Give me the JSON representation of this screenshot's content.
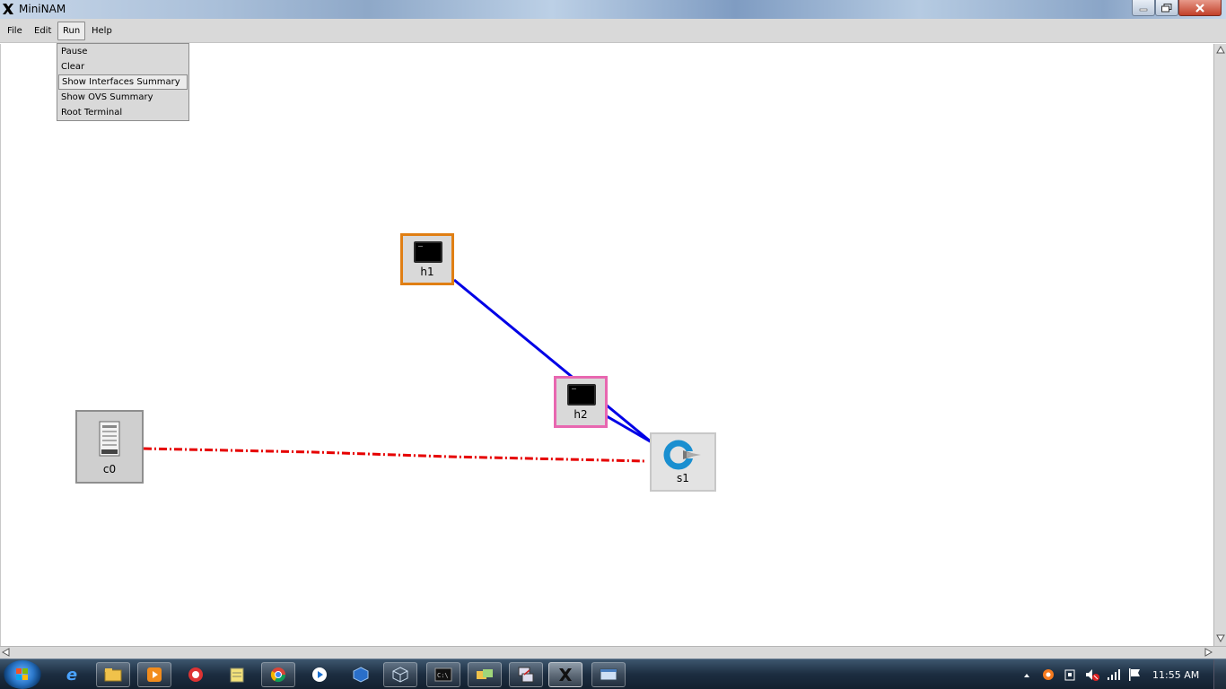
{
  "window": {
    "title": "MiniNAM"
  },
  "menubar": {
    "items": [
      {
        "label": "File"
      },
      {
        "label": "Edit"
      },
      {
        "label": "Run"
      },
      {
        "label": "Help"
      }
    ]
  },
  "run_menu": {
    "items": [
      {
        "label": "Pause"
      },
      {
        "label": "Clear"
      },
      {
        "label": "Show Interfaces Summary",
        "highlighted": true
      },
      {
        "label": "Show OVS Summary"
      },
      {
        "label": "Root Terminal"
      }
    ]
  },
  "topology": {
    "nodes": [
      {
        "id": "h1",
        "label": "h1",
        "kind": "host",
        "border_color": "#e07f14"
      },
      {
        "id": "h2",
        "label": "h2",
        "kind": "host",
        "border_color": "#e867b0"
      },
      {
        "id": "s1",
        "label": "s1",
        "kind": "switch"
      },
      {
        "id": "c0",
        "label": "c0",
        "kind": "controller"
      }
    ],
    "links": [
      {
        "from": "h1",
        "to": "s1",
        "style": "solid",
        "color": "#0000e6"
      },
      {
        "from": "h2",
        "to": "s1",
        "style": "solid",
        "color": "#0000e6"
      },
      {
        "from": "c0",
        "to": "s1",
        "style": "dash-dot",
        "color": "#e60000"
      }
    ]
  },
  "taskbar": {
    "icons": [
      "windows-start-icon",
      "internet-explorer-icon",
      "file-explorer-icon",
      "media-player-icon",
      "browser-icon",
      "notepad-icon",
      "chrome-icon",
      "video-player-icon",
      "virtualbox-icon",
      "virtualbox-vm-icon",
      "command-prompt-icon",
      "remote-folders-icon",
      "putty-icon",
      "xming-icon",
      "window-app-icon"
    ],
    "clock": "11:55 AM"
  },
  "colors": {
    "menubar_bg": "#d9d9d9",
    "link_blue": "#0000e6",
    "link_red": "#e60000",
    "h1_border": "#e07f14",
    "h2_border": "#e867b0"
  }
}
